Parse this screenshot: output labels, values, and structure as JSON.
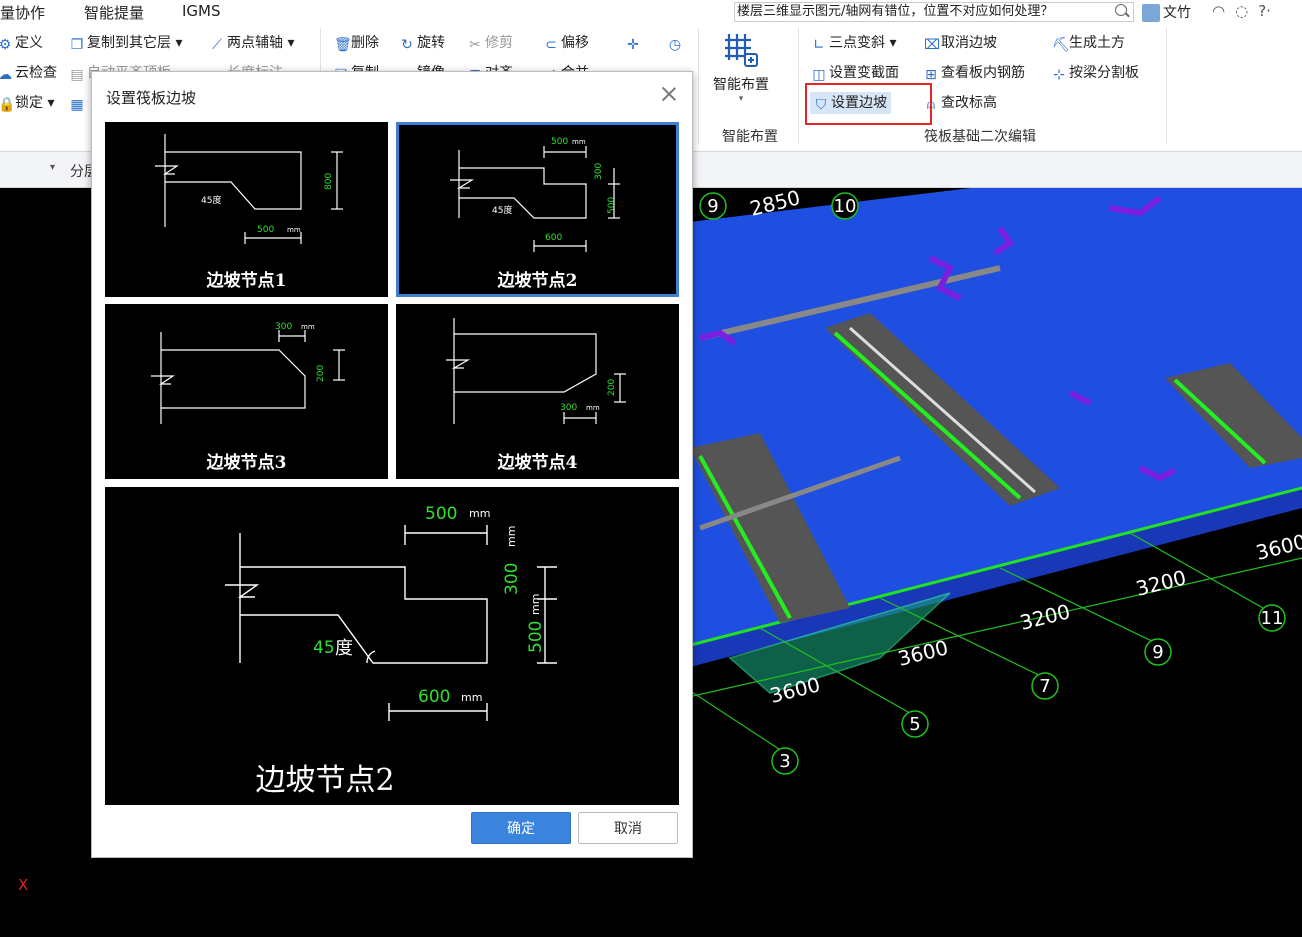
{
  "menubar": {
    "items": [
      "量协作",
      "智能提量",
      "IGMS"
    ],
    "search_text": "楼层三维显示图元/轴网有错位，位置不对应如何处理？",
    "user_name": "文竹",
    "right_icons": [
      "headset-icon",
      "chat-icon",
      "help-icon"
    ],
    "help_label": "?·"
  },
  "ribbon": {
    "col1": [
      "定义",
      "云检查",
      "锁定"
    ],
    "col2": [
      "复制到其它层",
      "自动平齐顶板"
    ],
    "col2_icon3": "layer-icon",
    "col3": [
      "两点辅轴",
      "长度标注"
    ],
    "col4": [
      "删除",
      "复制"
    ],
    "col5": [
      "旋转",
      "镜像"
    ],
    "col6": [
      "修剪",
      "对齐"
    ],
    "col7": [
      "偏移",
      "合并"
    ],
    "smart_layout": {
      "label": "智能布置",
      "group_label": "智能布置"
    },
    "raft_edit": {
      "row1": [
        "三点变斜",
        "取消边坡",
        "生成土方"
      ],
      "row2": [
        "设置变截面",
        "查看板内钢筋",
        "按梁分割板"
      ],
      "row3": [
        "设置边坡",
        "查改标高"
      ],
      "group_label": "筏板基础二次编辑"
    }
  },
  "subbar": {
    "label": "分层"
  },
  "viewport": {
    "axis_labels": [
      "9",
      "10",
      "11",
      "9",
      "7",
      "5",
      "3"
    ],
    "dimensions": [
      "2850",
      "3600",
      "3200",
      "3200",
      "3600",
      "3600"
    ],
    "axis_indicator": "X"
  },
  "dialog": {
    "title": "设置筏板边坡",
    "options": [
      {
        "caption": "边坡节点1",
        "angle_label": "45度",
        "dim_a": "500",
        "dim_b": "800",
        "unit": "mm"
      },
      {
        "caption": "边坡节点2",
        "angle_label": "45度",
        "dim_a": "500",
        "dim_b": "600",
        "dim_c": "300",
        "dim_d": "500",
        "unit": "mm"
      },
      {
        "caption": "边坡节点3",
        "dim_a": "300",
        "dim_b": "200",
        "unit": "mm"
      },
      {
        "caption": "边坡节点4",
        "dim_a": "300",
        "dim_b": "200",
        "unit": "mm"
      }
    ],
    "selected_index": 1,
    "preview": {
      "caption": "边坡节点2",
      "dim_top": "500",
      "dim_bottom": "600",
      "dim_right_upper": "300",
      "dim_right_lower": "500",
      "angle_value": "45",
      "angle_unit": "度",
      "unit": "mm"
    },
    "ok_label": "确定",
    "cancel_label": "取消"
  },
  "colors": {
    "accent": "#3b84de",
    "highlight": "#e5252a",
    "raft_blue": "#1f4fe0",
    "dim_green": "#20e020"
  }
}
